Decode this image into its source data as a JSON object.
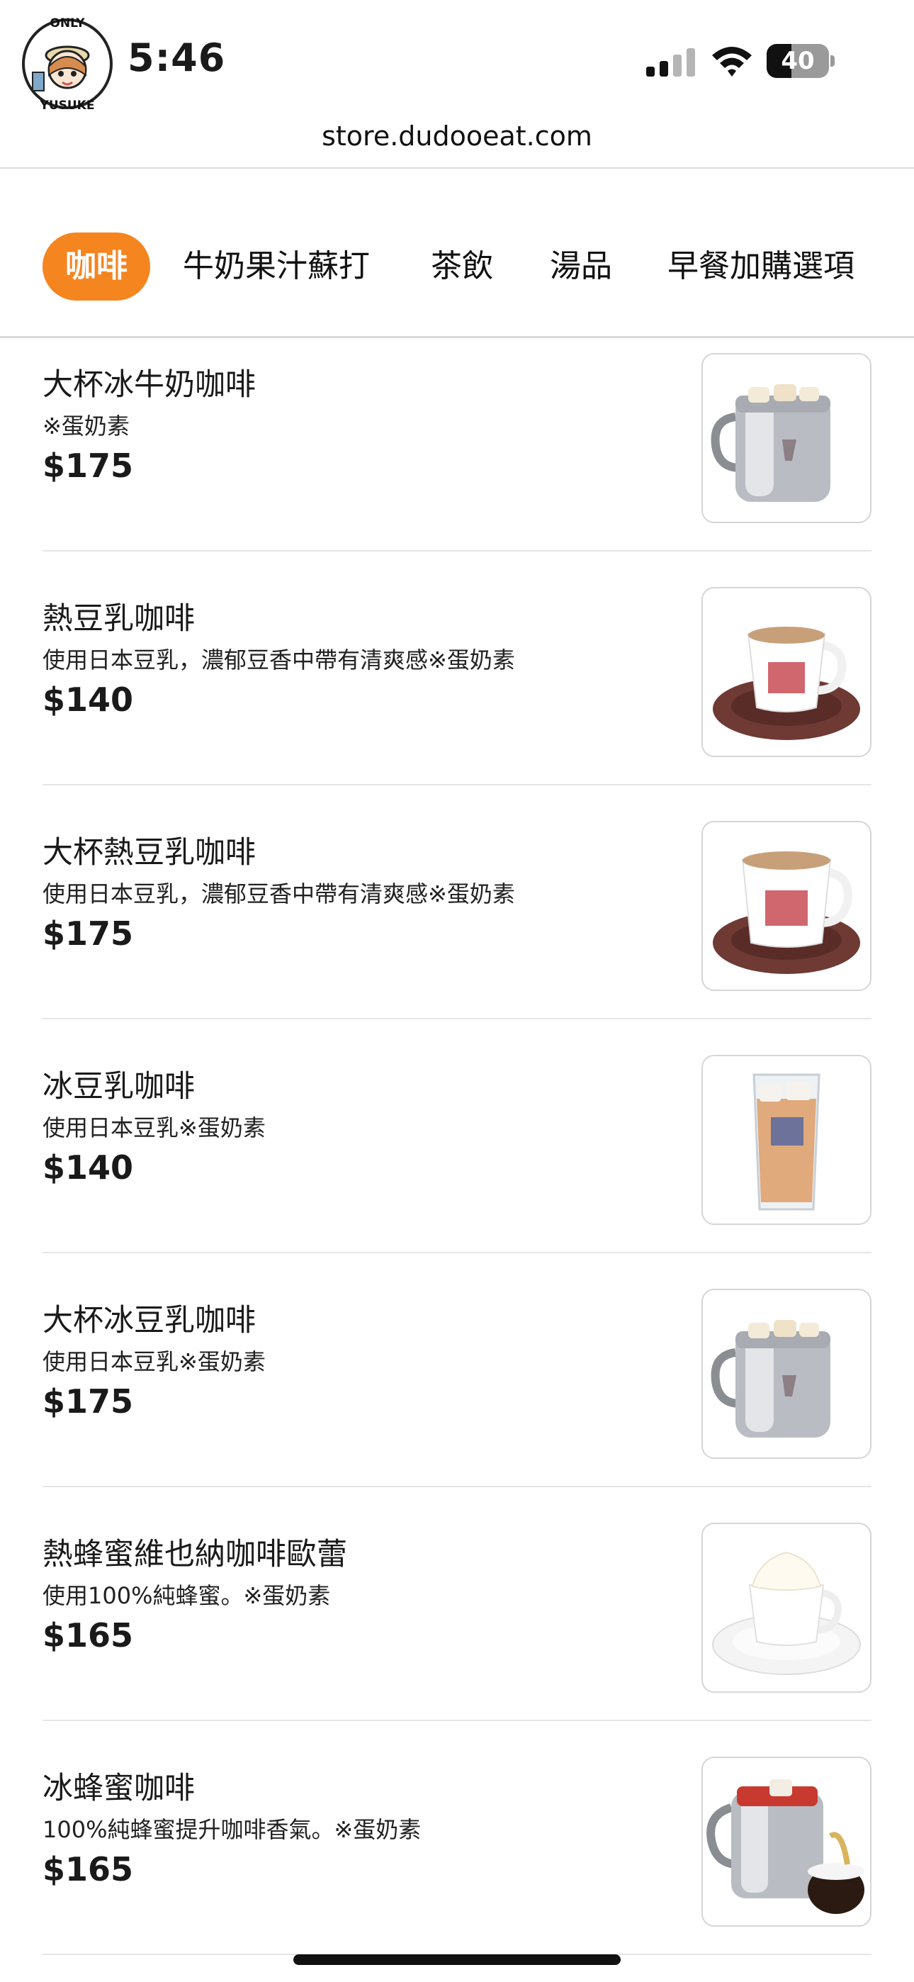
{
  "status_bar": {
    "logo_text_top": "ONLY",
    "logo_text_bottom": "YUSUKE",
    "time": "5:46",
    "battery_level": 40,
    "battery_text": "40",
    "signal_bars_active": 2,
    "signal_bars_total": 4
  },
  "browser": {
    "url": "store.dudooeat.com"
  },
  "tabs": [
    {
      "label": "咖啡",
      "active": true
    },
    {
      "label": "牛奶果汁蘇打",
      "active": false
    },
    {
      "label": "茶飲",
      "active": false
    },
    {
      "label": "湯品",
      "active": false
    },
    {
      "label": "早餐加購選項",
      "active": false
    }
  ],
  "colors": {
    "accent": "#f5851f",
    "divider": "#e6e6e6"
  },
  "menu_items": [
    {
      "name": "大杯冰牛奶咖啡",
      "desc": "※蛋奶素",
      "price": "$175",
      "image": "iced-mug-icon"
    },
    {
      "name": "熱豆乳咖啡",
      "desc": "使用日本豆乳，濃郁豆香中帶有清爽感※蛋奶素",
      "price": "$140",
      "image": "coffee-cup-saucer-icon"
    },
    {
      "name": "大杯熱豆乳咖啡",
      "desc": "使用日本豆乳，濃郁豆香中帶有清爽感※蛋奶素",
      "price": "$175",
      "image": "large-coffee-cup-saucer-icon"
    },
    {
      "name": "冰豆乳咖啡",
      "desc": "使用日本豆乳※蛋奶素",
      "price": "$140",
      "image": "iced-glass-icon"
    },
    {
      "name": "大杯冰豆乳咖啡",
      "desc": "使用日本豆乳※蛋奶素",
      "price": "$175",
      "image": "iced-mug-icon"
    },
    {
      "name": "熱蜂蜜維也納咖啡歐蕾",
      "desc": "使用100%純蜂蜜。※蛋奶素",
      "price": "$165",
      "image": "cream-cup-icon"
    },
    {
      "name": "冰蜂蜜咖啡",
      "desc": "100%純蜂蜜提升咖啡香氣。※蛋奶素",
      "price": "$165",
      "image": "iced-honey-mug-icon"
    }
  ]
}
